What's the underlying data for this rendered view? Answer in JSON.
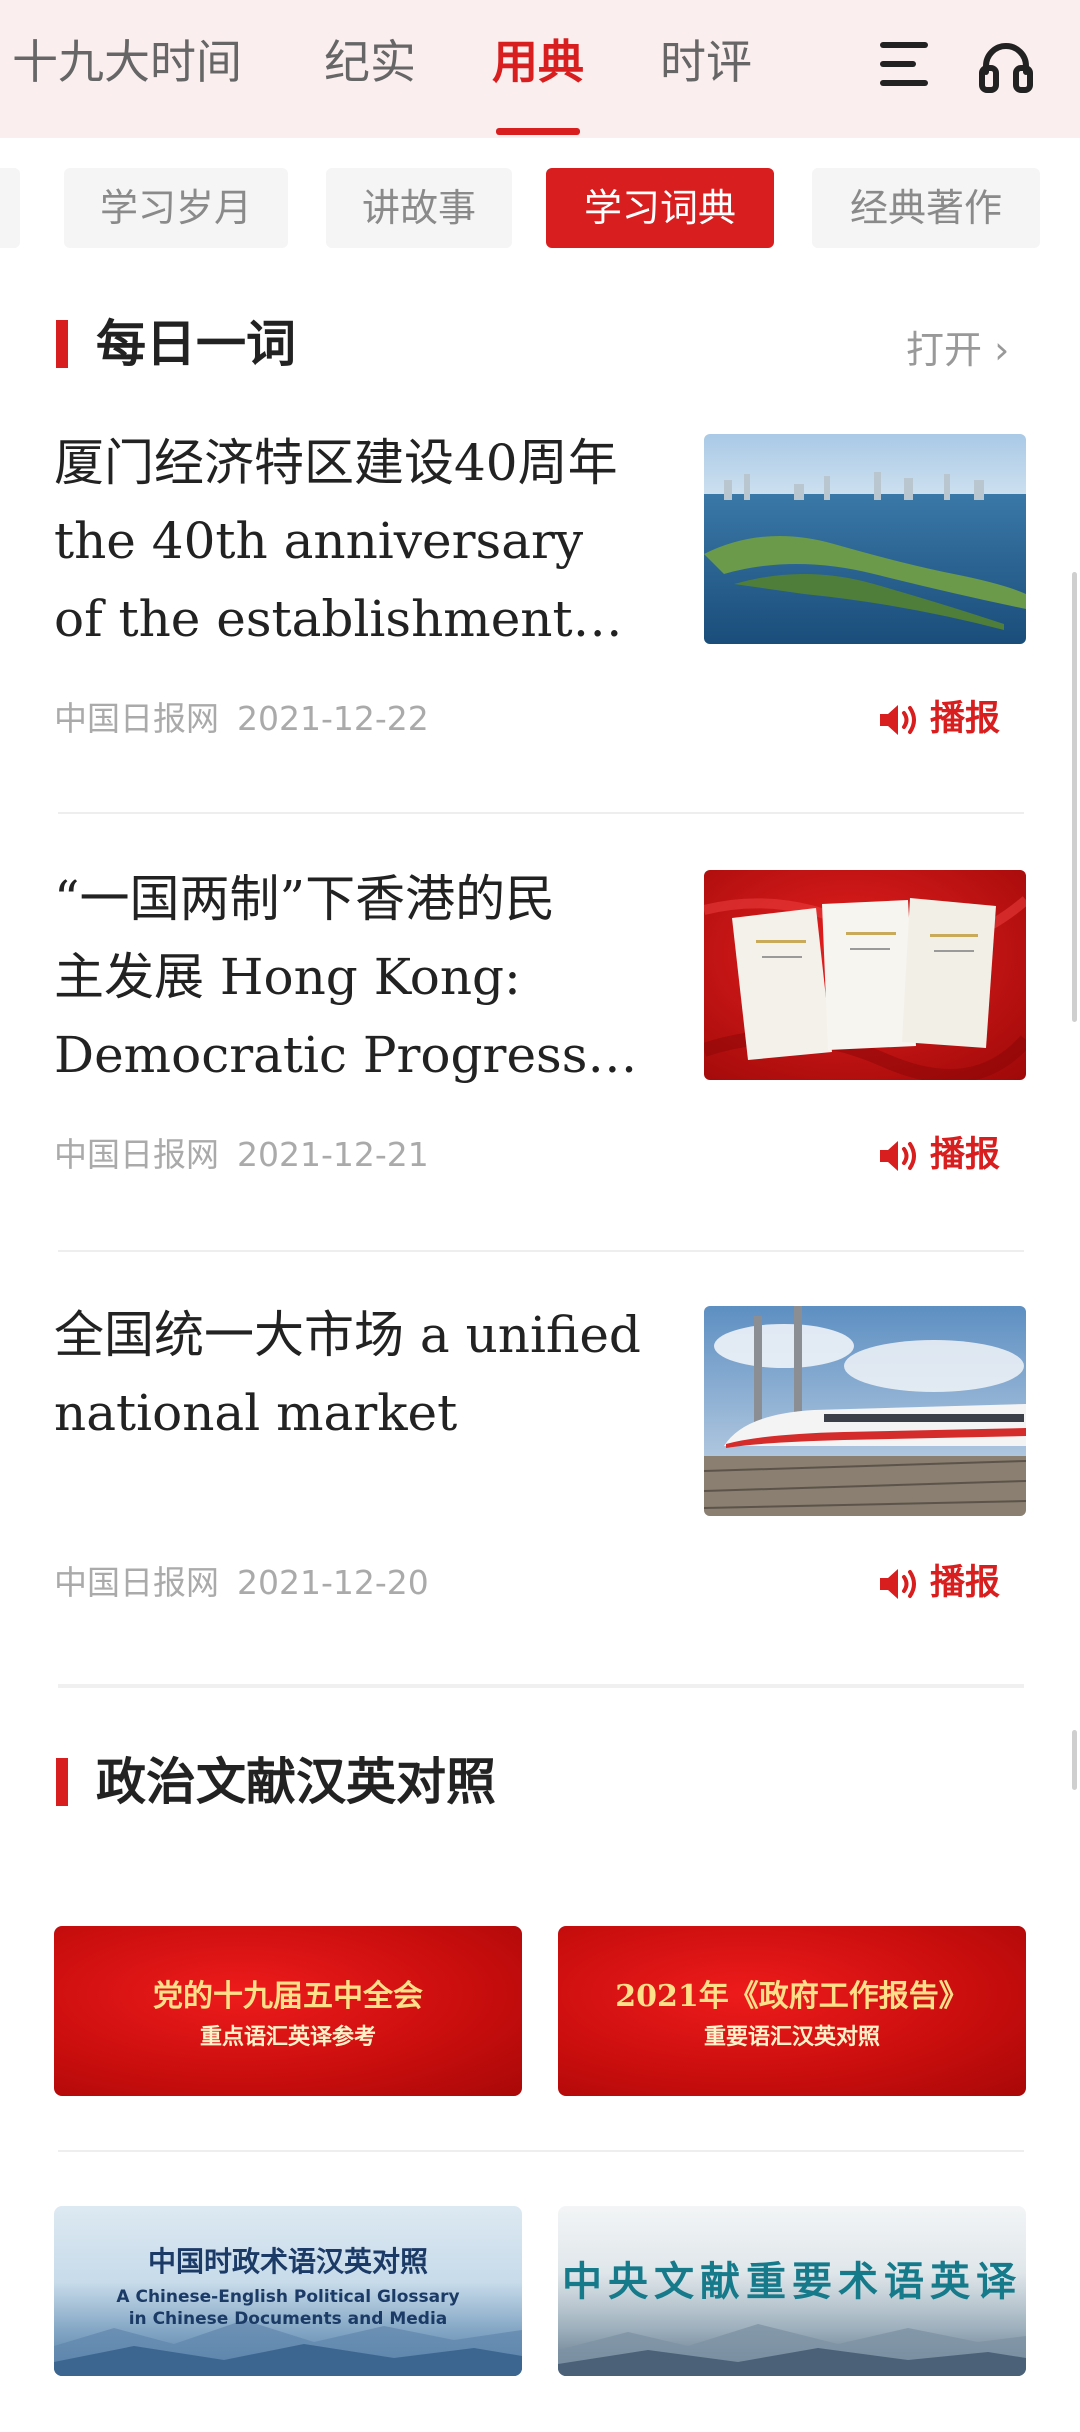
{
  "top_nav": {
    "tabs": [
      {
        "label": "十九大时间"
      },
      {
        "label": "纪实"
      },
      {
        "label": "用典"
      },
      {
        "label": "时评"
      }
    ],
    "active_index": 2,
    "menu_icon": "menu-icon",
    "audio_icon": "headphones-icon"
  },
  "sub_tabs": {
    "items": [
      {
        "label": "学习岁月"
      },
      {
        "label": "讲故事"
      },
      {
        "label": "学习词典"
      },
      {
        "label": "经典著作"
      }
    ],
    "active_index": 2
  },
  "daily_word": {
    "title": "每日一词",
    "open_label": "打开 ›",
    "articles": [
      {
        "title_lines": [
          "厦门经济特区建设40周年",
          "the 40th anniversary",
          "of the establishment…"
        ],
        "source": "中国日报网",
        "date": "2021-12-22",
        "play_label": "播报",
        "thumbnail": "xiamen-waterfront-photo"
      },
      {
        "title_lines": [
          "“一国两制”下香港的民",
          "主发展 Hong Kong:",
          "Democratic Progress…"
        ],
        "source": "中国日报网",
        "date": "2021-12-21",
        "play_label": "播报",
        "thumbnail": "white-paper-books-photo"
      },
      {
        "title_lines": [
          "全国统一大市场 a unified",
          "national market"
        ],
        "source": "中国日报网",
        "date": "2021-12-20",
        "play_label": "播报",
        "thumbnail": "high-speed-train-photo"
      }
    ]
  },
  "political_docs": {
    "title": "政治文献汉英对照",
    "cards": [
      {
        "line1": "党的十九届五中全会",
        "line2": "重点语汇英译参考",
        "style": "red"
      },
      {
        "line1": "2021年《政府工作报告》",
        "line2": "重要语汇汉英对照",
        "style": "red"
      },
      {
        "line1": "中国时政术语汉英对照",
        "line2": "A Chinese-English Political Glossary",
        "line3": "in Chinese Documents and Media",
        "style": "blue"
      },
      {
        "line1": "中央文献重要术语英译",
        "style": "mist"
      }
    ]
  },
  "colors": {
    "accent": "#d81e1e",
    "nav_background": "#fbeeee",
    "muted_text": "#aaaaaa"
  }
}
